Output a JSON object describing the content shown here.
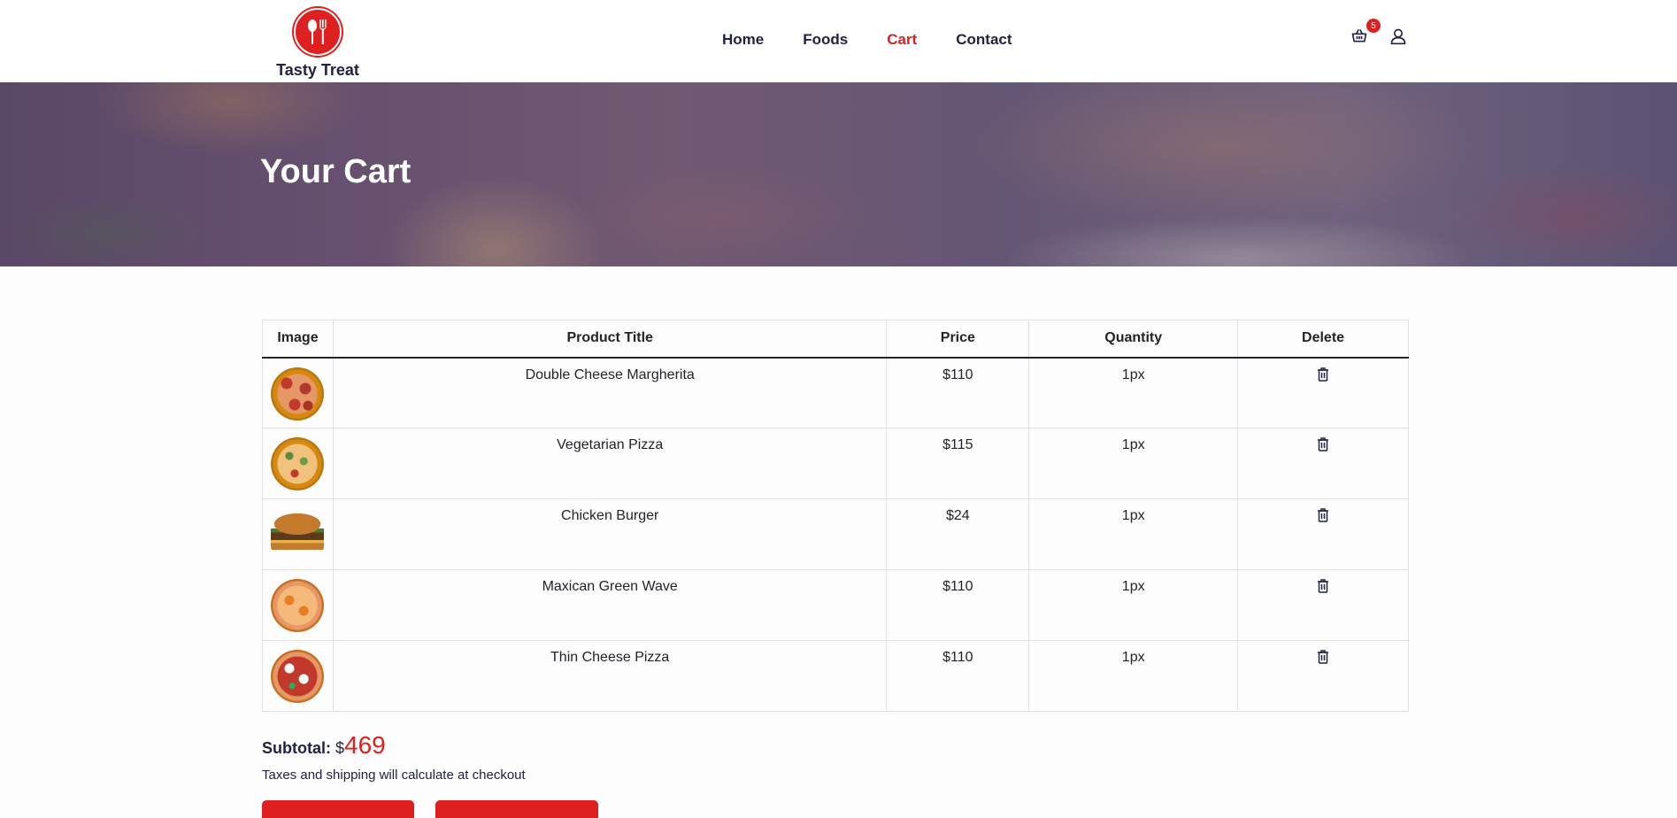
{
  "brand": {
    "name": "Tasty Treat",
    "accent_color": "#df2020"
  },
  "nav": {
    "items": [
      {
        "label": "Home"
      },
      {
        "label": "Foods"
      },
      {
        "label": "Cart"
      },
      {
        "label": "Contact"
      }
    ],
    "active": "Cart"
  },
  "header_icons": {
    "cart_icon": "shopping-basket-icon",
    "cart_count": "5",
    "user_icon": "user-icon"
  },
  "hero": {
    "title": "Your Cart"
  },
  "cart_table": {
    "headers": [
      "Image",
      "Product Title",
      "Price",
      "Quantity",
      "Delete"
    ],
    "rows": [
      {
        "title": "Double Cheese Margherita",
        "price": "$110",
        "quantity": "1px",
        "image": "pizza-image"
      },
      {
        "title": "Vegetarian Pizza",
        "price": "$115",
        "quantity": "1px",
        "image": "pizza-image"
      },
      {
        "title": "Chicken Burger",
        "price": "$24",
        "quantity": "1px",
        "image": "burger-image"
      },
      {
        "title": "Maxican Green Wave",
        "price": "$110",
        "quantity": "1px",
        "image": "pizza-image"
      },
      {
        "title": "Thin Cheese Pizza",
        "price": "$110",
        "quantity": "1px",
        "image": "pizza-image"
      }
    ]
  },
  "summary": {
    "subtotal_label": "Subtotal:",
    "currency": "$",
    "subtotal_amount": "469",
    "tax_note": "Taxes and shipping will calculate at checkout"
  }
}
